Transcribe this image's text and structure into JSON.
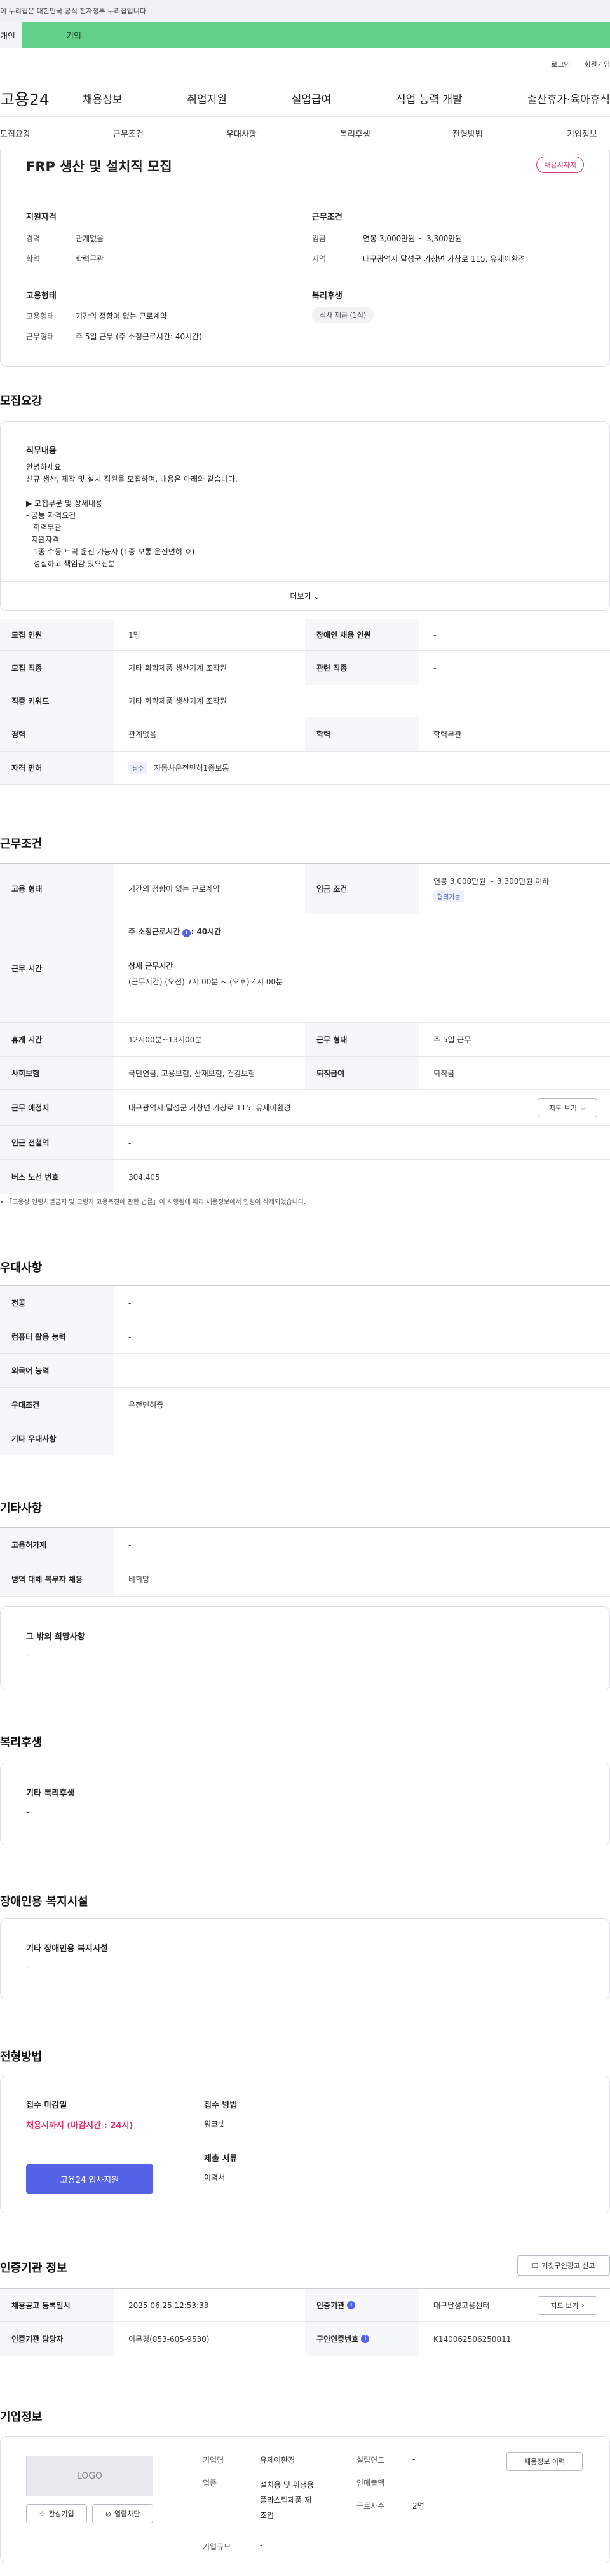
{
  "topbar": {
    "notice": "이 누리집은 대한민국 공식 전자정부 누리집입니다."
  },
  "tabs": {
    "individual": "개인",
    "corporate": "기업"
  },
  "util": {
    "login": "로그인",
    "signup": "회원가입"
  },
  "gnb": {
    "logo": "고용24",
    "items": [
      "채용정보",
      "취업지원",
      "실업급여",
      "직업 능력 개발",
      "출산휴가·육아휴직"
    ]
  },
  "subnav": [
    "모집요강",
    "근무조건",
    "우대사항",
    "복리후생",
    "전형방법",
    "기업정보"
  ],
  "job": {
    "title": "FRP 생산 및 설치직 모집",
    "badge": "채용시까지",
    "qual_title": "지원자격",
    "exp_label": "경력",
    "exp": "관계없음",
    "edu_label": "학력",
    "edu": "학력무관",
    "cond_title": "근무조건",
    "wage_label": "임금",
    "wage": "연봉 3,000만원 ~ 3,300만원",
    "loc_label": "지역",
    "loc": "대구광역시 달성군 가창면 가창로 115, 유제이환경",
    "emp_title": "고용형태",
    "emptype_label": "고용형태",
    "emptype": "기간의 정함이 없는 근로계약",
    "worktype_label": "근무형태",
    "worktype": "주 5일 근무 (주 소정근로시간: 40시간)",
    "welfare_title": "복리후생",
    "welfare_chip": "식사 제공 (1식)"
  },
  "recruit": {
    "section": "모집요강",
    "desc_title": "직무내용",
    "desc_lines": [
      "안녕하세요",
      "신규 생산, 제작 및 설치 직원을 모집하며, 내용은 아래와 같습니다.",
      "",
      "▶ 모집부분 및 상세내용",
      "- 공통 자격요건",
      "   학력무관",
      "- 지원자격",
      "   1종 수동 트럭 운전 가능자 (1종 보통 운전면허 ㅇ)",
      "   성실하고 책임감 있으신분"
    ],
    "more": "더보기",
    "rows": [
      {
        "l1": "모집 인원",
        "v1": "1명",
        "l2": "장애인 채용 인원",
        "v2": "-"
      },
      {
        "l1": "모집 직종",
        "v1": "기타 화학제품 생산기계 조작원",
        "l2": "관련 직종",
        "v2": "-"
      },
      {
        "l1": "직종 키워드",
        "v1": "기타 화학제품 생산기계 조작원"
      },
      {
        "l1": "경력",
        "v1": "관계없음",
        "l2": "학력",
        "v2": "학력무관"
      },
      {
        "l1": "자격 면허",
        "tag": "필수",
        "v1": "자동차운전면허1종보통"
      }
    ]
  },
  "work": {
    "section": "근무조건",
    "emp_label": "고용 형태",
    "emp": "기간의 정함이 없는 근로계약",
    "wage_label": "임금 조건",
    "wage": "연봉 3,000만원 ~ 3,300만원 이하",
    "wage_tag": "협의가능",
    "hours_label": "근무 시간",
    "hours_week": "주 소정근로시간",
    "hours_week_val": ": 40시간",
    "hours_detail_title": "상세 근무시간",
    "hours_detail": "(근무시간) (오전) 7시 00분 ~ (오후) 4시 00분",
    "break_label": "휴게 시간",
    "break": "12시00분~13시00분",
    "form_label": "근무 형태",
    "form": "주 5일 근무",
    "ins_label": "사회보험",
    "ins": "국민연금, 고용보험, 산재보험, 건강보험",
    "sev_label": "퇴직급여",
    "sev": "퇴직금",
    "place_label": "근무 예정지",
    "place": "대구광역시 달성군 가창면 가창로 115, 유제이환경",
    "map_btn": "지도 보기",
    "subway_label": "인근 전철역",
    "subway": "-",
    "bus_label": "버스 노선 번호",
    "bus": "304,405",
    "notice": "「고용상 연령차별금지 및 고령자 고용촉진에 관한 법률」이 시행됨에 따라 채용정보에서 연령이 삭제되었습니다."
  },
  "pref": {
    "section": "우대사항",
    "rows": [
      {
        "l": "전공",
        "v": "-"
      },
      {
        "l": "컴퓨터 활용 능력",
        "v": "-"
      },
      {
        "l": "외국어 능력",
        "v": "-"
      },
      {
        "l": "우대조건",
        "v": "운전면허증"
      },
      {
        "l": "기타 우대사항",
        "v": "-"
      }
    ]
  },
  "etc": {
    "section": "기타사항",
    "rows": [
      {
        "l": "고용허가제",
        "v": "-"
      },
      {
        "l": "병역 대체 복무자 채용",
        "v": "비희망"
      }
    ],
    "other_title": "그 밖의 희망사항",
    "other_val": "-"
  },
  "welfare": {
    "section": "복리후생",
    "box_title": "기타 복리후생",
    "box_val": "-"
  },
  "disab": {
    "section": "장애인용 복지시설",
    "box_title": "기타 장애인용 복지시설",
    "box_val": "-"
  },
  "process": {
    "section": "전형방법",
    "deadline_title": "접수 마감일",
    "deadline": "채용시까지 (마감시간 : 24시)",
    "apply_btn": "고용24 입사지원",
    "method_title": "접수 방법",
    "method": "워크넷",
    "doc_title": "제출 서류",
    "doc": "이력서"
  },
  "agency": {
    "section": "인증기관 정보",
    "report_btn": "거짓구인광고 신고",
    "reg_label": "채용공고 등록일시",
    "reg": "2025.06.25 12:53:33",
    "org_label": "인증기관",
    "org": "대구달성고용센터",
    "map_btn": "지도 보기",
    "mgr_label": "인증기관 담당자",
    "mgr": "이무경(053-605-9530)",
    "no_label": "구인인증번호",
    "no": "K140062506250011"
  },
  "company": {
    "section": "기업정보",
    "logo": "LOGO",
    "fav_btn": "관심기업",
    "block_btn": "열람차단",
    "name_label": "기업명",
    "name": "유제이환경",
    "ind_label": "업종",
    "ind": [
      "설치용 및 위생용",
      "플라스틱제품 제",
      "조업"
    ],
    "scale_label": "기업규모",
    "scale": "-",
    "year_label": "설립연도",
    "year": "-",
    "sales_label": "연매출액",
    "sales": "-",
    "emp_label": "근로자수",
    "emp": "2명",
    "history_btn": "채용정보 이력"
  },
  "colors": {
    "accent": "#5362e6",
    "pink": "#e0326e",
    "green": "#63d08a"
  }
}
